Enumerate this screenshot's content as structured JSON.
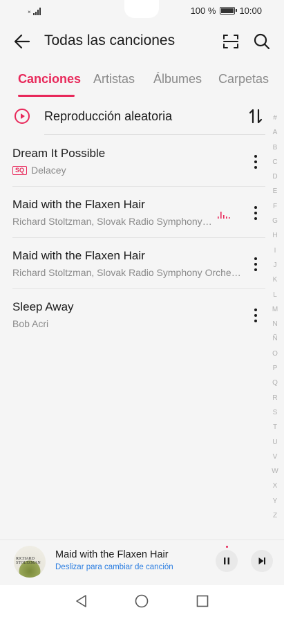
{
  "status_bar": {
    "battery": "100 %",
    "time": "10:00",
    "battery_level": 1.0
  },
  "header": {
    "title": "Todas las canciones"
  },
  "tabs": [
    {
      "label": "Canciones",
      "active": true
    },
    {
      "label": "Artistas",
      "active": false
    },
    {
      "label": "Álbumes",
      "active": false
    },
    {
      "label": "Carpetas",
      "active": false
    }
  ],
  "shuffle": {
    "label": "Reproducción aleatoria"
  },
  "songs": [
    {
      "title": "Dream It Possible",
      "artist": "Delacey",
      "badge": "SQ",
      "playing": false
    },
    {
      "title": "Maid with the Flaxen Hair",
      "artist": "Richard Stoltzman, Slovak Radio Symphony Orchestra",
      "playing": true
    },
    {
      "title": "Maid with the Flaxen Hair",
      "artist": "Richard Stoltzman, Slovak Radio Symphony Orchestra",
      "playing": false
    },
    {
      "title": "Sleep Away",
      "artist": "Bob Acri",
      "playing": false
    }
  ],
  "index_letters": [
    "#",
    "A",
    "B",
    "C",
    "D",
    "E",
    "F",
    "G",
    "H",
    "I",
    "J",
    "K",
    "L",
    "M",
    "N",
    "Ñ",
    "O",
    "P",
    "Q",
    "R",
    "S",
    "T",
    "U",
    "V",
    "W",
    "X",
    "Y",
    "Z"
  ],
  "now_playing": {
    "title": "Maid with the Flaxen Hair",
    "subtitle": "Deslizar para cambiar de canción",
    "album_art_text": [
      "RICHARD",
      "STOLTZMAN"
    ]
  },
  "colors": {
    "accent": "#e8285a",
    "link": "#2a7de1",
    "text": "#1a1a1a",
    "secondary": "#8a8a8a"
  },
  "icons": {
    "back": "arrow-left-icon",
    "scan": "scan-icon",
    "search": "search-icon",
    "shuffle": "play-circle-icon",
    "sort": "sort-icon",
    "more": "more-vertical-icon",
    "equalizer": "equalizer-icon",
    "pause": "pause-icon",
    "next": "skip-next-icon",
    "nav_back": "nav-back-icon",
    "nav_home": "nav-home-icon",
    "nav_recent": "nav-recent-icon"
  }
}
